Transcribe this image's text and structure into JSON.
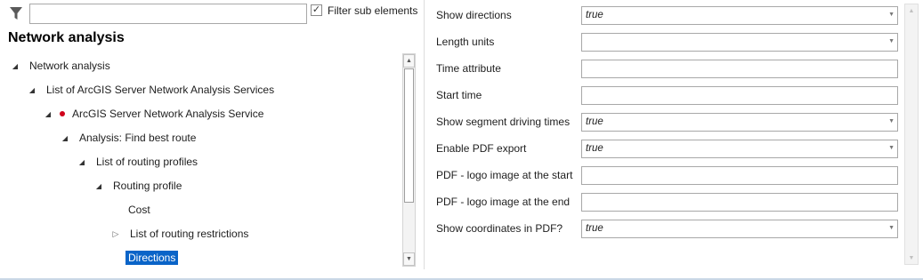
{
  "filter": {
    "placeholder": "",
    "value": "",
    "sub_elements_label": "Filter sub elements",
    "sub_elements_checked": "✓"
  },
  "pane_title": "Network analysis",
  "tree": [
    {
      "label": "Network analysis",
      "toggle": "◢",
      "name": "tree-node-network-analysis",
      "selected": false,
      "dot": false
    },
    {
      "label": "List of ArcGIS Server Network Analysis Services",
      "toggle": "◢",
      "name": "tree-node-list-of-arcgis-services",
      "selected": false,
      "dot": false
    },
    {
      "label": "ArcGIS Server Network Analysis Service",
      "toggle": "◢",
      "name": "tree-node-arcgis-service",
      "selected": false,
      "dot": true
    },
    {
      "label": "Analysis: Find best route",
      "toggle": "◢",
      "name": "tree-node-find-best-route",
      "selected": false,
      "dot": false
    },
    {
      "label": "List of routing profiles",
      "toggle": "◢",
      "name": "tree-node-list-of-routing-profiles",
      "selected": false,
      "dot": false
    },
    {
      "label": "Routing profile",
      "toggle": "◢",
      "name": "tree-node-routing-profile",
      "selected": false,
      "dot": false
    },
    {
      "label": "Cost",
      "toggle": "",
      "name": "tree-node-cost",
      "selected": false,
      "dot": false
    },
    {
      "label": "List of routing restrictions",
      "toggle": "▷",
      "name": "tree-node-list-of-routing-restrictions",
      "selected": false,
      "dot": false
    },
    {
      "label": "Directions",
      "toggle": "",
      "name": "tree-node-directions",
      "selected": true,
      "dot": false
    }
  ],
  "properties": [
    {
      "label": "Show directions",
      "value": "true",
      "dropdown": true,
      "name": "show-directions"
    },
    {
      "label": "Length units",
      "value": "",
      "dropdown": true,
      "name": "length-units"
    },
    {
      "label": "Time attribute",
      "value": "",
      "dropdown": false,
      "name": "time-attribute"
    },
    {
      "label": "Start time",
      "value": "",
      "dropdown": false,
      "name": "start-time"
    },
    {
      "label": "Show segment driving times",
      "value": "true",
      "dropdown": true,
      "name": "show-segment-driving-times"
    },
    {
      "label": "Enable PDF export",
      "value": "true",
      "dropdown": true,
      "name": "enable-pdf-export"
    },
    {
      "label": "PDF - logo image at the start",
      "value": "",
      "dropdown": false,
      "name": "pdf-logo-start"
    },
    {
      "label": "PDF - logo image at the end",
      "value": "",
      "dropdown": false,
      "name": "pdf-logo-end"
    },
    {
      "label": "Show coordinates in PDF?",
      "value": "true",
      "dropdown": true,
      "name": "show-coordinates-in-pdf"
    }
  ],
  "icons": {
    "dropdown": "▼",
    "scroll_up": "▲",
    "scroll_down": "▼"
  },
  "colors": {
    "selection": "#0a64c8",
    "modified_dot": "#d0021b"
  }
}
